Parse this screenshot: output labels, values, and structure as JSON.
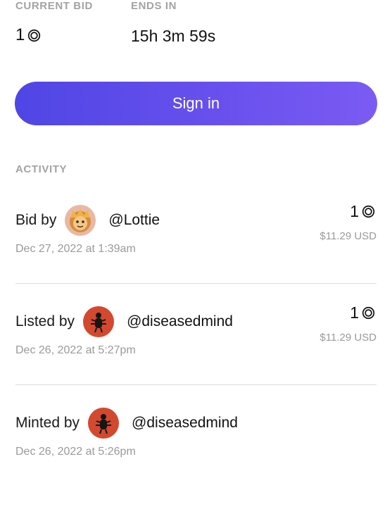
{
  "auction": {
    "current_bid_label": "CURRENT BID",
    "current_bid_value": "1",
    "ends_in_label": "ENDS IN",
    "ends_in_value": "15h 3m 59s"
  },
  "cta": {
    "sign_in_label": "Sign in"
  },
  "activity": {
    "label": "ACTIVITY",
    "items": [
      {
        "action": "Bid by",
        "user": "@Lottie",
        "date": "Dec 27, 2022 at 1:39am",
        "price": "1",
        "usd": "$11.29 USD",
        "avatar_icon": "lottie-avatar"
      },
      {
        "action": "Listed by",
        "user": "@diseasedmind",
        "date": "Dec 26, 2022 at 5:27pm",
        "price": "1",
        "usd": "$11.29 USD",
        "avatar_icon": "diseasedmind-avatar"
      },
      {
        "action": "Minted by",
        "user": "@diseasedmind",
        "date": "Dec 26, 2022 at 5:26pm",
        "avatar_icon": "diseasedmind-avatar"
      }
    ]
  },
  "colors": {
    "button_gradient_start": "#4f46e5",
    "button_gradient_end": "#7b5bf2",
    "muted_text": "#a3a3a3",
    "divider": "#dcdcdc",
    "avatar_red": "#d2492f"
  },
  "icons": {
    "currency": "tezos-icon"
  }
}
